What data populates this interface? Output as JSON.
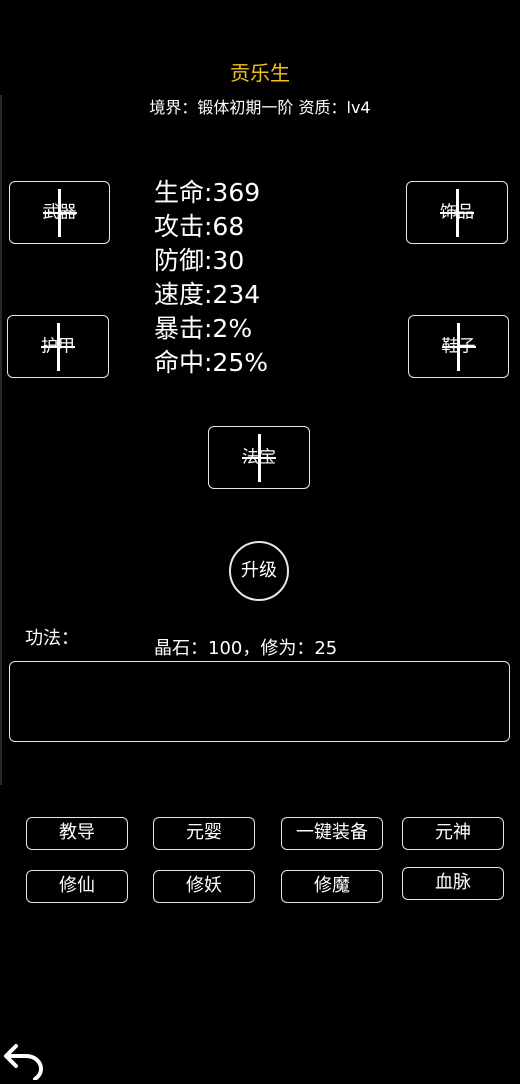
{
  "header": {
    "name": "贡乐生",
    "realm_line": "境界：锻体初期一阶 资质：lv4"
  },
  "equipment": {
    "weapon": "武器",
    "accessory": "饰品",
    "armor": "护甲",
    "shoes": "鞋子",
    "treasure": "法宝"
  },
  "stats": [
    "生命:369",
    "攻击:68",
    "防御:30",
    "速度:234",
    "暴击:2%",
    "命中:25%"
  ],
  "upgrade_label": "升级",
  "skills": {
    "label": "功法：",
    "resources": "晶石：100，修为：25"
  },
  "menu": {
    "row1": [
      "教导",
      "元婴",
      "一键装备",
      "元神"
    ],
    "row2": [
      "修仙",
      "修妖",
      "修魔",
      "血脉"
    ]
  },
  "colors": {
    "name": "#f2c21a",
    "background": "#000000",
    "border": "#e6e6e6"
  },
  "icons": {
    "back": "back-arrow-icon"
  }
}
